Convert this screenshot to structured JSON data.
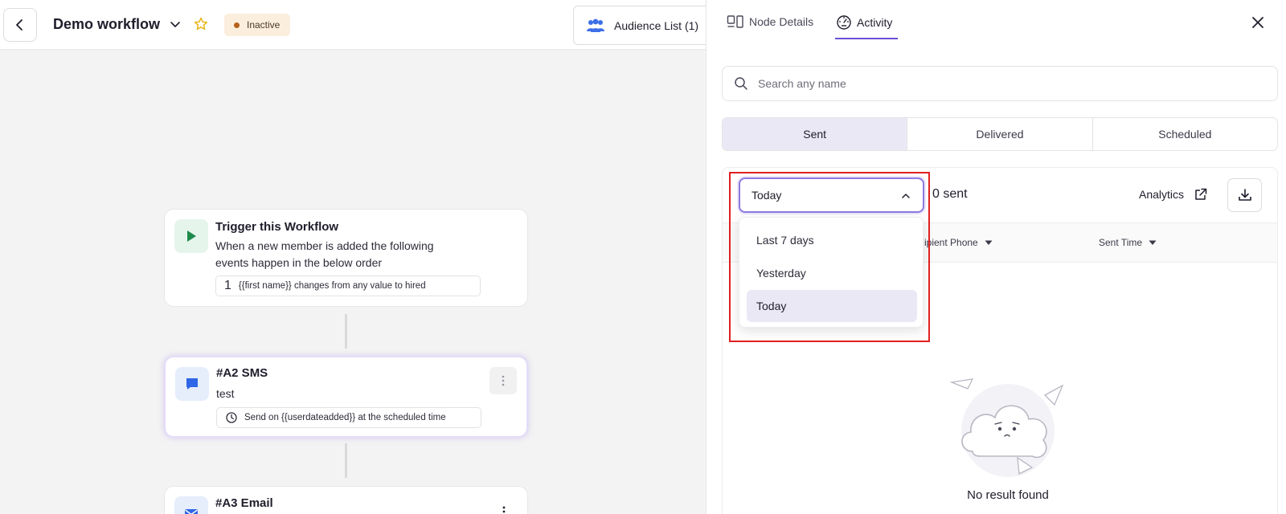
{
  "header": {
    "title": "Demo workflow",
    "status": "Inactive",
    "audience_label": "Audience List (1)"
  },
  "canvas": {
    "trigger": {
      "title": "Trigger this Workflow",
      "desc_line1": "When a new member is added the following",
      "desc_line2": "events happen in the below order",
      "rule_number": "1",
      "rule_text": "{{first name}} changes from any value to hired"
    },
    "sms": {
      "title": "#A2 SMS",
      "desc": "test",
      "schedule": "Send on {{userdateadded}} at the scheduled time"
    },
    "email": {
      "title": "#A3 Email"
    }
  },
  "panel": {
    "tabs": [
      {
        "label": "Node Details"
      },
      {
        "label": "Activity"
      }
    ],
    "search_placeholder": "Search any name",
    "segments": [
      "Sent",
      "Delivered",
      "Scheduled"
    ],
    "date_filter": "Today",
    "sent_count": "0 sent",
    "analytics_label": "Analytics",
    "columns": [
      {
        "label": "ipient Phone"
      },
      {
        "label": "Sent Time"
      }
    ],
    "dropdown_options": [
      "Last 7 days",
      "Yesterday",
      "Today"
    ],
    "empty_text": "No result found"
  },
  "colors": {
    "accent": "#6a4fd6",
    "selected_bg": "#ebe8f6",
    "inactive_badge": "#fbeedd",
    "highlight": "#e02020"
  }
}
